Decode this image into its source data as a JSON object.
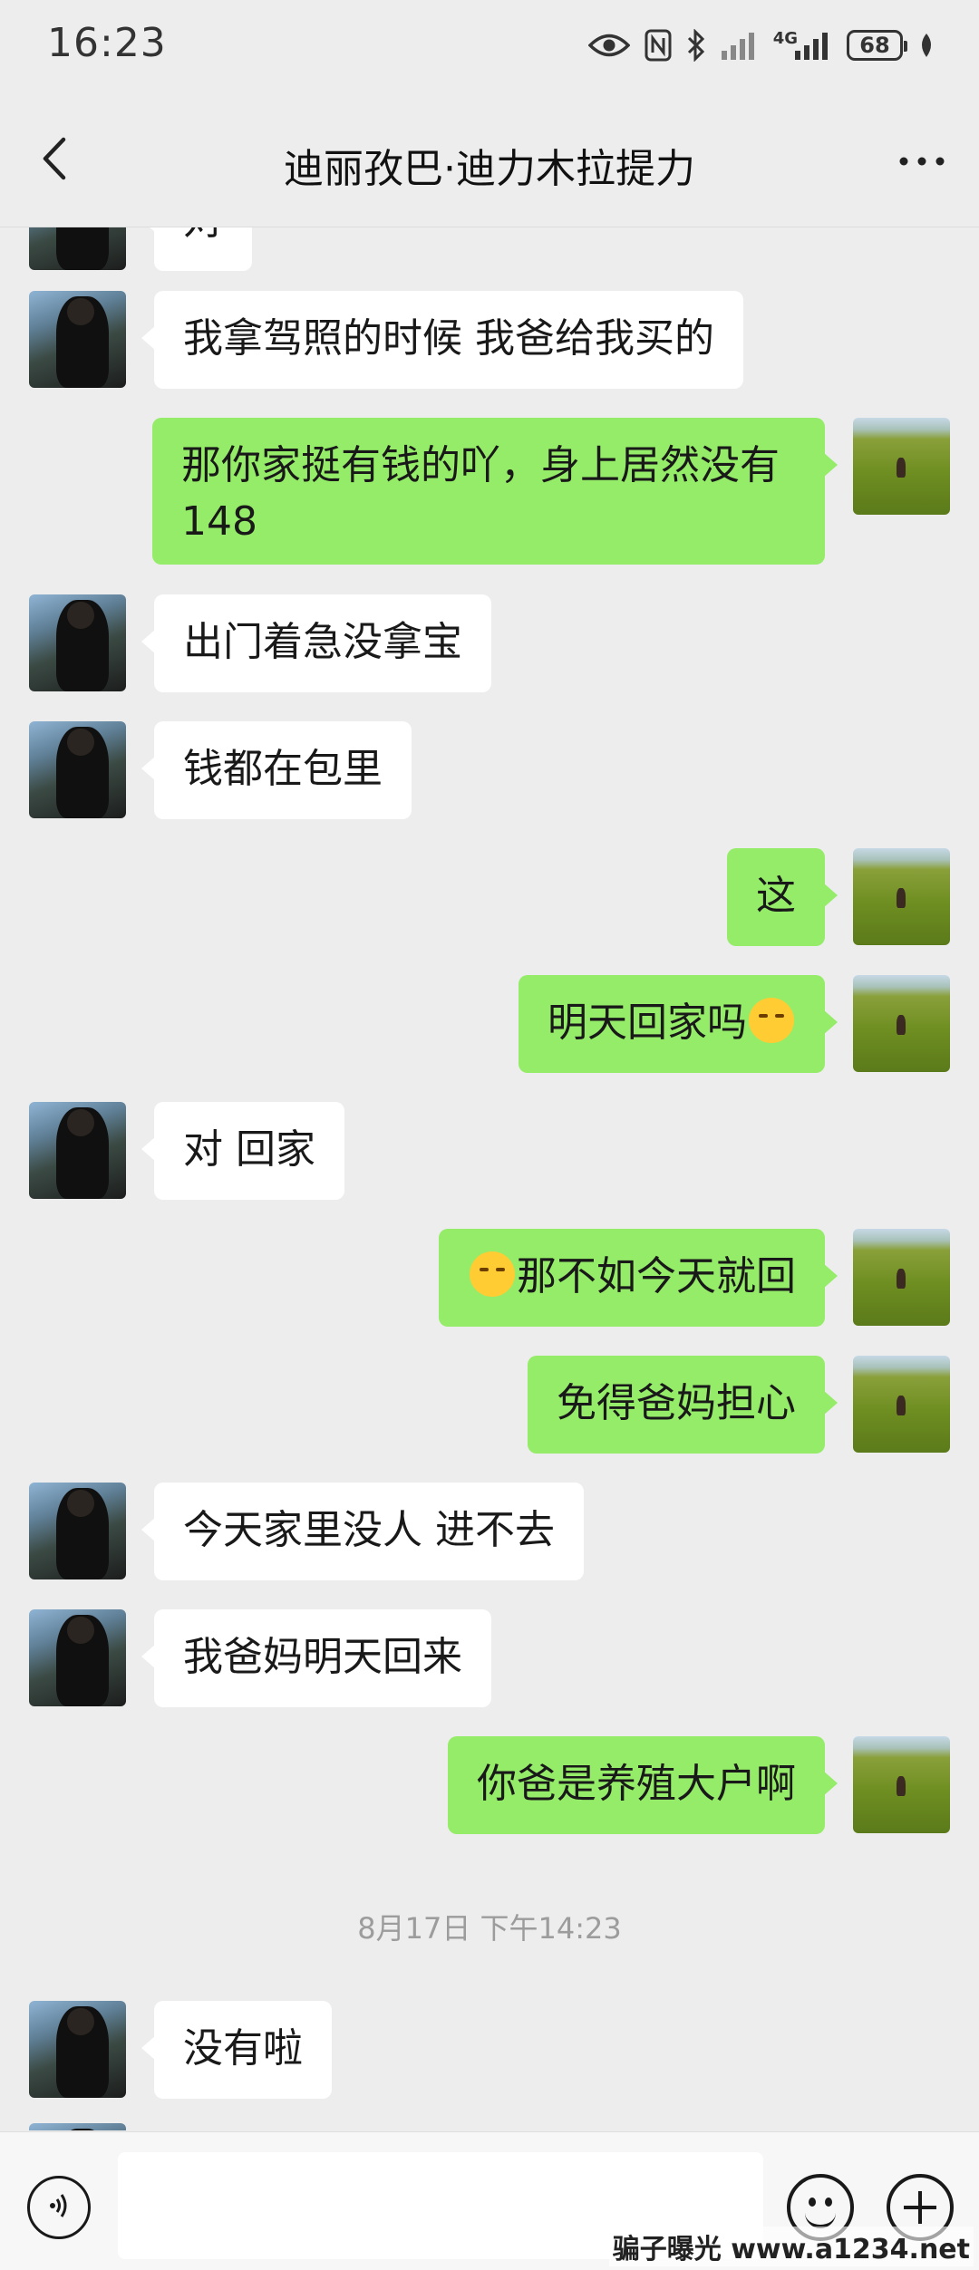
{
  "status_bar": {
    "time": "16:23",
    "network": "4G",
    "battery": "68",
    "icons": [
      "eye-icon",
      "nfc-icon",
      "bluetooth-icon",
      "signal-icon",
      "signal-4g-icon",
      "battery-icon",
      "leaf-icon"
    ]
  },
  "header": {
    "title": "迪丽孜巴·迪力木拉提力",
    "back_icon": "chevron-left-icon",
    "more_icon": "more-dots-icon"
  },
  "messages": [
    {
      "side": "left",
      "sender": "friend",
      "text": "对"
    },
    {
      "side": "left",
      "sender": "friend",
      "text": "我拿驾照的时候 我爸给我买的"
    },
    {
      "side": "right",
      "sender": "me",
      "text": "那你家挺有钱的吖，身上居然没有148"
    },
    {
      "side": "left",
      "sender": "friend",
      "text": "出门着急没拿宝"
    },
    {
      "side": "left",
      "sender": "friend",
      "text": "钱都在包里"
    },
    {
      "side": "right",
      "sender": "me",
      "text": "这"
    },
    {
      "side": "right",
      "sender": "me",
      "text": "明天回家吗",
      "emoji_after": "kissing-face-emoji"
    },
    {
      "side": "left",
      "sender": "friend",
      "text": "对 回家"
    },
    {
      "side": "right",
      "sender": "me",
      "text": "那不如今天就回",
      "emoji_before": "crying-laughing-emoji"
    },
    {
      "side": "right",
      "sender": "me",
      "text": "免得爸妈担心"
    },
    {
      "side": "left",
      "sender": "friend",
      "text": "今天家里没人 进不去"
    },
    {
      "side": "left",
      "sender": "friend",
      "text": "我爸妈明天回来"
    },
    {
      "side": "right",
      "sender": "me",
      "text": "你爸是养殖大户啊"
    },
    {
      "timestamp": "8月17日 下午14:23"
    },
    {
      "side": "left",
      "sender": "friend",
      "text": "没有啦"
    }
  ],
  "input_bar": {
    "voice_icon": "voice-icon",
    "input_value": "",
    "emoji_icon": "smiley-icon",
    "plus_icon": "plus-icon"
  },
  "watermark": "骗子曝光 www.a1234.net",
  "colors": {
    "background": "#ededed",
    "bubble_me": "#95ec69",
    "bubble_friend": "#ffffff",
    "timestamp": "#9c9c9c"
  }
}
